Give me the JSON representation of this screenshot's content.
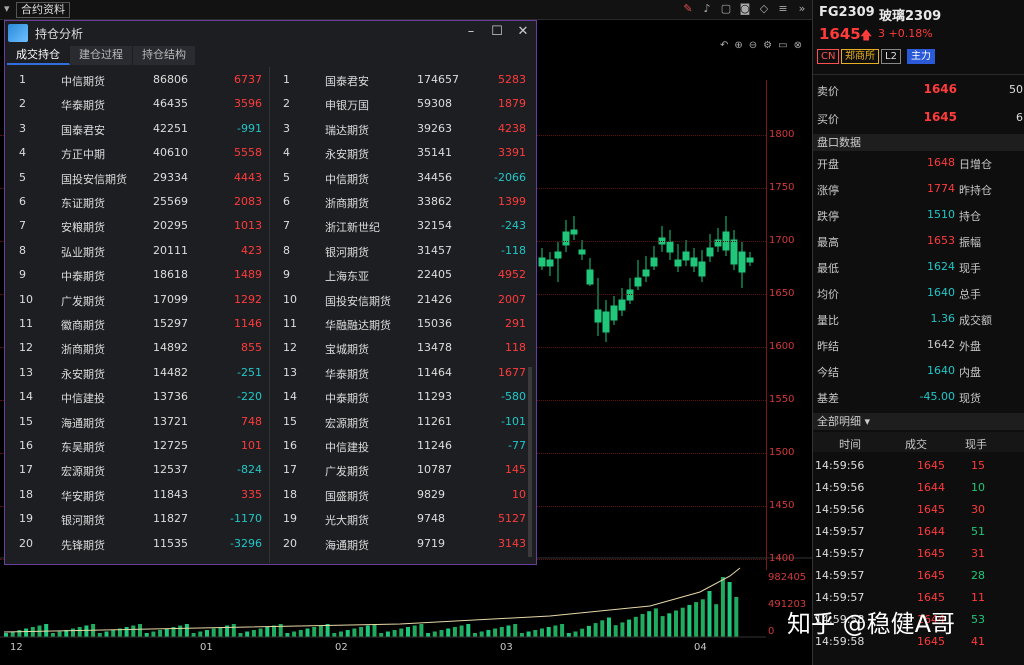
{
  "topbar": {
    "tab_label": "合约资料"
  },
  "chart": {
    "price_ticks": [
      "1800",
      "1750",
      "1700",
      "1650",
      "1600",
      "1550",
      "1500",
      "1450",
      "1400"
    ],
    "volume_ticks": [
      "982405",
      "491203",
      "0"
    ],
    "date_ticks": [
      "12",
      "01",
      "02",
      "03",
      "04"
    ]
  },
  "dialog": {
    "title": "持仓分析",
    "tabs": [
      "成交持仓",
      "建仓过程",
      "持仓结构"
    ],
    "left": [
      {
        "rank": "1",
        "name": "中信期货",
        "vol": "86806",
        "chg": "6737"
      },
      {
        "rank": "2",
        "name": "华泰期货",
        "vol": "46435",
        "chg": "3596"
      },
      {
        "rank": "3",
        "name": "国泰君安",
        "vol": "42251",
        "chg": "-991"
      },
      {
        "rank": "4",
        "name": "方正中期",
        "vol": "40610",
        "chg": "5558"
      },
      {
        "rank": "5",
        "name": "国投安信期货",
        "vol": "29334",
        "chg": "4443"
      },
      {
        "rank": "6",
        "name": "东证期货",
        "vol": "25569",
        "chg": "2083"
      },
      {
        "rank": "7",
        "name": "安粮期货",
        "vol": "20295",
        "chg": "1013"
      },
      {
        "rank": "8",
        "name": "弘业期货",
        "vol": "20111",
        "chg": "423"
      },
      {
        "rank": "9",
        "name": "中泰期货",
        "vol": "18618",
        "chg": "1489"
      },
      {
        "rank": "10",
        "name": "广发期货",
        "vol": "17099",
        "chg": "1292"
      },
      {
        "rank": "11",
        "name": "徽商期货",
        "vol": "15297",
        "chg": "1146"
      },
      {
        "rank": "12",
        "name": "浙商期货",
        "vol": "14892",
        "chg": "855"
      },
      {
        "rank": "13",
        "name": "永安期货",
        "vol": "14482",
        "chg": "-251"
      },
      {
        "rank": "14",
        "name": "中信建投",
        "vol": "13736",
        "chg": "-220"
      },
      {
        "rank": "15",
        "name": "海通期货",
        "vol": "13721",
        "chg": "748"
      },
      {
        "rank": "16",
        "name": "东吴期货",
        "vol": "12725",
        "chg": "101"
      },
      {
        "rank": "17",
        "name": "宏源期货",
        "vol": "12537",
        "chg": "-824"
      },
      {
        "rank": "18",
        "name": "华安期货",
        "vol": "11843",
        "chg": "335"
      },
      {
        "rank": "19",
        "name": "银河期货",
        "vol": "11827",
        "chg": "-1170"
      },
      {
        "rank": "20",
        "name": "先锋期货",
        "vol": "11535",
        "chg": "-3296"
      }
    ],
    "right": [
      {
        "rank": "1",
        "name": "国泰君安",
        "vol": "174657",
        "chg": "5283"
      },
      {
        "rank": "2",
        "name": "申银万国",
        "vol": "59308",
        "chg": "1879"
      },
      {
        "rank": "3",
        "name": "瑞达期货",
        "vol": "39263",
        "chg": "4238"
      },
      {
        "rank": "4",
        "name": "永安期货",
        "vol": "35141",
        "chg": "3391"
      },
      {
        "rank": "5",
        "name": "中信期货",
        "vol": "34456",
        "chg": "-2066"
      },
      {
        "rank": "6",
        "name": "浙商期货",
        "vol": "33862",
        "chg": "1399"
      },
      {
        "rank": "7",
        "name": "浙江新世纪",
        "vol": "32154",
        "chg": "-243"
      },
      {
        "rank": "8",
        "name": "银河期货",
        "vol": "31457",
        "chg": "-118"
      },
      {
        "rank": "9",
        "name": "上海东亚",
        "vol": "22405",
        "chg": "4952"
      },
      {
        "rank": "10",
        "name": "国投安信期货",
        "vol": "21426",
        "chg": "2007"
      },
      {
        "rank": "11",
        "name": "华融融达期货",
        "vol": "15036",
        "chg": "291"
      },
      {
        "rank": "12",
        "name": "宝城期货",
        "vol": "13478",
        "chg": "118"
      },
      {
        "rank": "13",
        "name": "华泰期货",
        "vol": "11464",
        "chg": "1677"
      },
      {
        "rank": "14",
        "name": "中泰期货",
        "vol": "11293",
        "chg": "-580"
      },
      {
        "rank": "15",
        "name": "宏源期货",
        "vol": "11261",
        "chg": "-101"
      },
      {
        "rank": "16",
        "name": "中信建投",
        "vol": "11246",
        "chg": "-77"
      },
      {
        "rank": "17",
        "name": "广发期货",
        "vol": "10787",
        "chg": "145"
      },
      {
        "rank": "18",
        "name": "国盛期货",
        "vol": "9829",
        "chg": "10"
      },
      {
        "rank": "19",
        "name": "光大期货",
        "vol": "9748",
        "chg": "5127"
      },
      {
        "rank": "20",
        "name": "海通期货",
        "vol": "9719",
        "chg": "3143"
      }
    ]
  },
  "quote": {
    "code": "FG2309",
    "name": "玻璃2309",
    "price": "1645",
    "change": "3",
    "change_pct": "+0.18%",
    "badges": [
      "CN",
      "郑商所",
      "L2",
      "主力"
    ],
    "ask_label": "卖价",
    "ask": "1646",
    "ask_vol": "50",
    "bid_label": "买价",
    "bid": "1645",
    "bid_vol": "6",
    "section_title": "盘口数据",
    "stats": [
      {
        "l": "开盘",
        "v": "1648",
        "l2": "日增仓"
      },
      {
        "l": "涨停",
        "v": "1774",
        "l2": "昨持仓"
      },
      {
        "l": "跌停",
        "v": "1510",
        "l2": "持仓"
      },
      {
        "l": "最高",
        "v": "1653",
        "l2": "振幅"
      },
      {
        "l": "最低",
        "v": "1624",
        "l2": "现手"
      },
      {
        "l": "均价",
        "v": "1640",
        "l2": "总手"
      },
      {
        "l": "量比",
        "v": "1.36",
        "l2": "成交额"
      },
      {
        "l": "昨结",
        "v": "1642",
        "l2": "外盘"
      },
      {
        "l": "今结",
        "v": "1640",
        "l2": "内盘"
      },
      {
        "l": "基差",
        "v": "-45.00",
        "l2": "现货"
      }
    ],
    "ticks_title": "全部明细",
    "ticks_headers": [
      "时间",
      "成交",
      "现手"
    ],
    "ticks": [
      {
        "t": "14:59:56",
        "p": "1645",
        "v": "15"
      },
      {
        "t": "14:59:56",
        "p": "1644",
        "v": "10"
      },
      {
        "t": "14:59:56",
        "p": "1645",
        "v": "30"
      },
      {
        "t": "14:59:57",
        "p": "1644",
        "v": "51"
      },
      {
        "t": "14:59:57",
        "p": "1645",
        "v": "31"
      },
      {
        "t": "14:59:57",
        "p": "1645",
        "v": "28"
      },
      {
        "t": "14:59:57",
        "p": "1645",
        "v": "11"
      },
      {
        "t": "14:59:58",
        "p": "1644",
        "v": "53"
      },
      {
        "t": "14:59:58",
        "p": "1645",
        "v": "41"
      }
    ]
  },
  "watermark": "知乎 @稳健A哥"
}
